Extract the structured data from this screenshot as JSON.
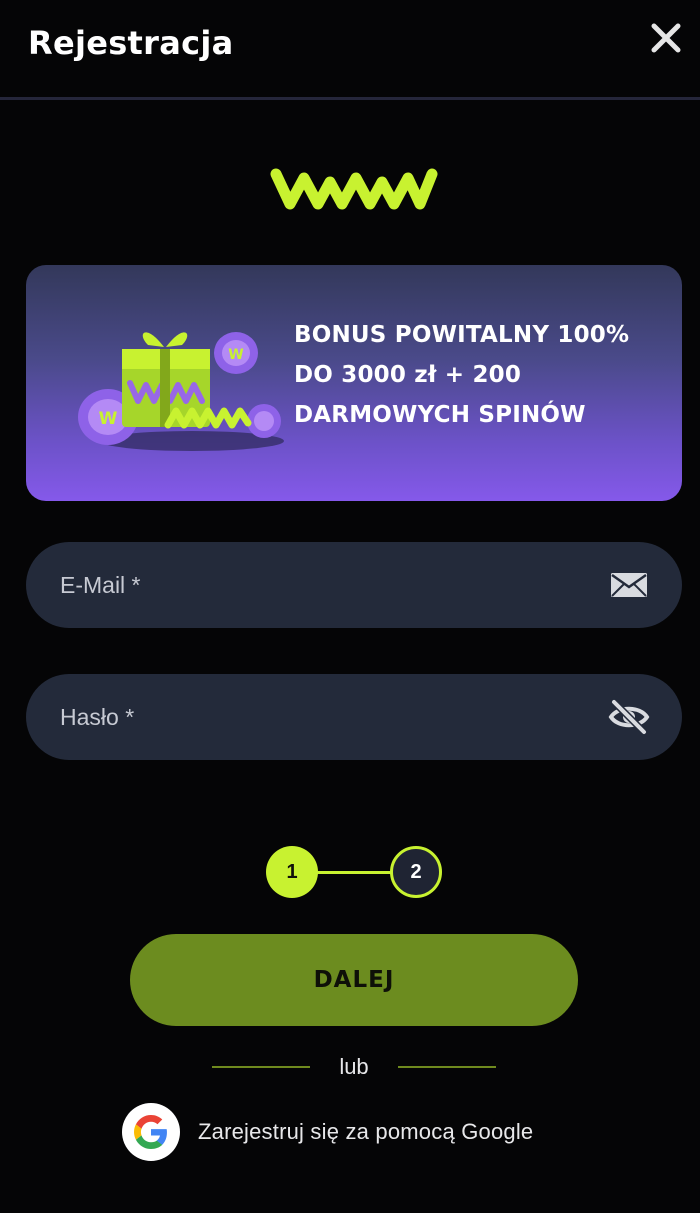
{
  "header": {
    "title": "Rejestracja",
    "close_icon": "close-icon"
  },
  "logo": {
    "icon": "ww-logo-icon",
    "color": "#c8f230"
  },
  "banner": {
    "lines": [
      "BONUS POWITALNY 100%",
      "DO 3000 zł + 200",
      "DARMOWYCH SPINÓW"
    ],
    "art_icon": "gift-box-with-chips-icon"
  },
  "form": {
    "email": {
      "placeholder": "E-Mail *",
      "icon": "envelope-icon"
    },
    "password": {
      "placeholder": "Hasło *",
      "icon": "eye-off-icon"
    }
  },
  "stepper": {
    "step1": "1",
    "step2": "2",
    "current": 1
  },
  "next_button": {
    "label": "DALEJ"
  },
  "divider": {
    "label": "lub"
  },
  "google": {
    "label": "Zarejestruj się za pomocą Google",
    "icon": "google-icon"
  },
  "colors": {
    "accent": "#c8f230",
    "button": "#6c8c1f",
    "background": "#050506",
    "field": "#232a3a",
    "banner_top": "#33385a",
    "banner_bottom": "#8559ea"
  }
}
